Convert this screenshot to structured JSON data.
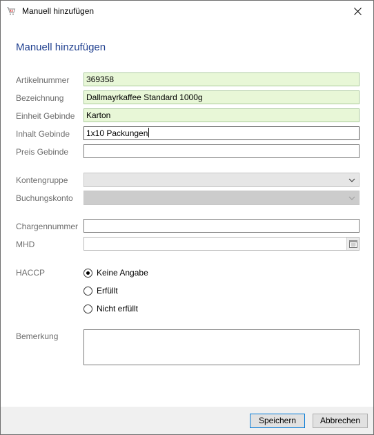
{
  "window": {
    "title": "Manuell hinzufügen"
  },
  "form": {
    "heading": "Manuell hinzufügen",
    "artikelnummer": {
      "label": "Artikelnummer",
      "value": "369358"
    },
    "bezeichnung": {
      "label": "Bezeichnung",
      "value": "Dallmayrkaffee Standard 1000g"
    },
    "einheit_gebinde": {
      "label": "Einheit Gebinde",
      "value": "Karton"
    },
    "inhalt_gebinde": {
      "label": "Inhalt Gebinde",
      "value": "1x10 Packungen"
    },
    "preis_gebinde": {
      "label": "Preis Gebinde",
      "value": ""
    },
    "kontengruppe": {
      "label": "Kontengruppe",
      "value": ""
    },
    "buchungskonto": {
      "label": "Buchungskonto",
      "value": ""
    },
    "chargennummer": {
      "label": "Chargennummer",
      "value": ""
    },
    "mhd": {
      "label": "MHD",
      "value": ""
    },
    "haccp": {
      "label": "HACCP",
      "options": [
        "Keine Angabe",
        "Erfüllt",
        "Nicht erfüllt"
      ],
      "selected": "Keine Angabe"
    },
    "bemerkung": {
      "label": "Bemerkung",
      "value": ""
    }
  },
  "footer": {
    "save_label": "Speichern",
    "cancel_label": "Abbrechen"
  },
  "colors": {
    "heading": "#1f3f8f",
    "filled_field": "#e8f7d7",
    "label": "#6d6d6d",
    "primary_border": "#0078d7"
  },
  "icons": {
    "app": "cart-icon",
    "close": "close-icon",
    "dropdown": "chevron-down-icon",
    "date": "calendar-icon"
  }
}
